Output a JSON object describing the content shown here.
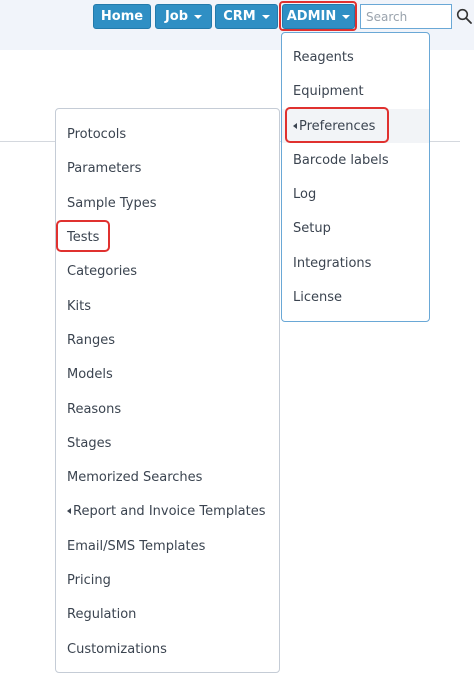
{
  "navbar": {
    "home_label": "Home",
    "job_label": "Job",
    "crm_label": "CRM",
    "admin_label": "ADMIN",
    "search_placeholder": "Search",
    "brand_color": "#2f8fc4",
    "highlight_color": "#e0312f"
  },
  "admin_menu": {
    "items": [
      {
        "label": "Reagents"
      },
      {
        "label": "Equipment"
      },
      {
        "label": "Preferences",
        "has_submenu": true,
        "active": true,
        "highlighted": true
      },
      {
        "label": "Barcode labels"
      },
      {
        "label": "Log"
      },
      {
        "label": "Setup"
      },
      {
        "label": "Integrations"
      },
      {
        "label": "License"
      }
    ]
  },
  "preferences_menu": {
    "items": [
      {
        "label": "Protocols"
      },
      {
        "label": "Parameters"
      },
      {
        "label": "Sample Types"
      },
      {
        "label": "Tests",
        "highlighted": true
      },
      {
        "label": "Categories"
      },
      {
        "label": "Kits"
      },
      {
        "label": "Ranges"
      },
      {
        "label": "Models"
      },
      {
        "label": "Reasons"
      },
      {
        "label": "Stages"
      },
      {
        "label": "Memorized Searches"
      },
      {
        "label": "Report and Invoice Templates",
        "has_submenu": true
      },
      {
        "label": "Email/SMS Templates"
      },
      {
        "label": "Pricing"
      },
      {
        "label": "Regulation"
      },
      {
        "label": "Customizations"
      }
    ]
  }
}
